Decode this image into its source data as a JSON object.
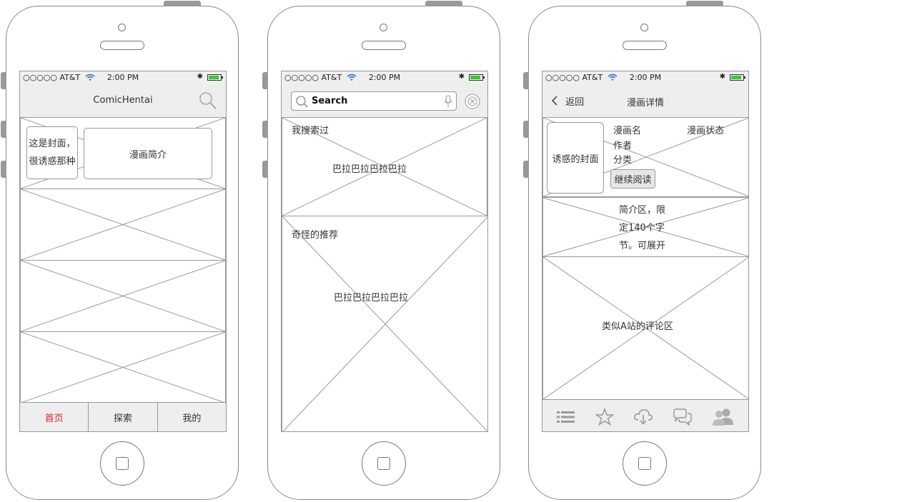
{
  "status": {
    "carrier": "○○○○○ AT&T",
    "time": "2:00 PM",
    "bluetooth": "✱",
    "battery_level": 0.85,
    "battery_color": "#33cc33"
  },
  "phone1": {
    "nav_title": "ComicHentai",
    "cover_text": "这是封面，很诱惑那种",
    "intro_text": "漫画简介",
    "tabs": [
      {
        "label": "首页",
        "color": "#e02020"
      },
      {
        "label": "探索",
        "color": "#333333"
      },
      {
        "label": "我的",
        "color": "#333333"
      }
    ]
  },
  "phone2": {
    "search_placeholder": "Search",
    "section1_title": "我搜索过",
    "section1_text": "巴拉巴拉巴拉巴拉",
    "section2_title": "奇怪的推荐",
    "section2_text": "巴拉巴拉巴拉巴拉"
  },
  "phone3": {
    "back_label": "返回",
    "nav_title": "漫画详情",
    "cover_text": "诱惑的封面",
    "comic_name": "漫画名",
    "comic_status": "漫画状态",
    "author": "作者",
    "category": "分类",
    "continue_button": "继续阅读",
    "summary_text": "简介区，限定140个字节。可展开",
    "comments_text": "类似A站的评论区",
    "toolbar_icons": [
      "list-icon",
      "star-icon",
      "cloud-download-icon",
      "chat-icon",
      "users-icon"
    ]
  }
}
